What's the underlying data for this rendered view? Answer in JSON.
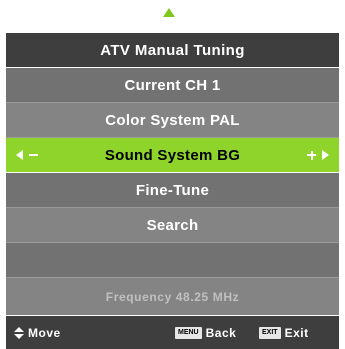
{
  "menu": {
    "title": "ATV Manual Tuning",
    "items": [
      {
        "label": "Current CH 1"
      },
      {
        "label": "Color System PAL"
      },
      {
        "label": "Sound System BG"
      },
      {
        "label": "Fine-Tune"
      },
      {
        "label": "Search"
      },
      {
        "label": ""
      }
    ],
    "frequency": "Frequency  48.25 MHz"
  },
  "footer": {
    "move": "Move",
    "menu_key": "MENU",
    "back": "Back",
    "exit_key": "EXIT",
    "exit": "Exit"
  },
  "colors": {
    "accent": "#8ed42a",
    "title_bg": "#3e3e3e",
    "row_bg": "#7a7a7a"
  }
}
